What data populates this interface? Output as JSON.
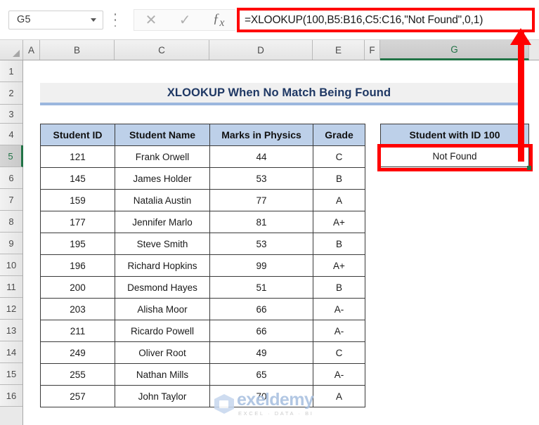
{
  "formula_bar": {
    "name_box_value": "G5",
    "cancel_icon": "cancel-x-icon",
    "confirm_icon": "confirm-check-icon",
    "function_icon": "fx-insert-function-icon",
    "formula": "=XLOOKUP(100,B5:B16,C5:C16,\"Not Found\",0,1)"
  },
  "grid": {
    "columns": [
      "A",
      "B",
      "C",
      "D",
      "E",
      "F",
      "G"
    ],
    "selected_column": "G",
    "rows": [
      "1",
      "2",
      "3",
      "4",
      "5",
      "6",
      "7",
      "8",
      "9",
      "10",
      "11",
      "12",
      "13",
      "14",
      "15",
      "16"
    ],
    "selected_row": "5"
  },
  "banner": {
    "title": "XLOOKUP When No Match Being Found"
  },
  "table": {
    "headers": [
      "Student ID",
      "Student Name",
      "Marks in Physics",
      "Grade"
    ],
    "rows": [
      [
        "121",
        "Frank Orwell",
        "44",
        "C"
      ],
      [
        "145",
        "James Holder",
        "53",
        "B"
      ],
      [
        "159",
        "Natalia Austin",
        "77",
        "A"
      ],
      [
        "177",
        "Jennifer Marlo",
        "81",
        "A+"
      ],
      [
        "195",
        "Steve Smith",
        "53",
        "B"
      ],
      [
        "196",
        "Richard Hopkins",
        "99",
        "A+"
      ],
      [
        "200",
        "Desmond Hayes",
        "51",
        "B"
      ],
      [
        "203",
        "Alisha Moor",
        "66",
        "A-"
      ],
      [
        "211",
        "Ricardo Powell",
        "66",
        "A-"
      ],
      [
        "249",
        "Oliver Root",
        "49",
        "C"
      ],
      [
        "255",
        "Nathan Mills",
        "65",
        "A-"
      ],
      [
        "257",
        "John Taylor",
        "70",
        "A"
      ]
    ]
  },
  "result": {
    "header": "Student with ID 100",
    "value": "Not Found"
  },
  "watermark": {
    "name": "exeldemy",
    "tagline": "EXCEL · DATA · BI"
  },
  "colors": {
    "accent_green": "#217346",
    "callout_red": "#ff0000",
    "header_blue": "#bdd0e9",
    "title_navy": "#1f3864",
    "banner_rule": "#9bb7de"
  }
}
